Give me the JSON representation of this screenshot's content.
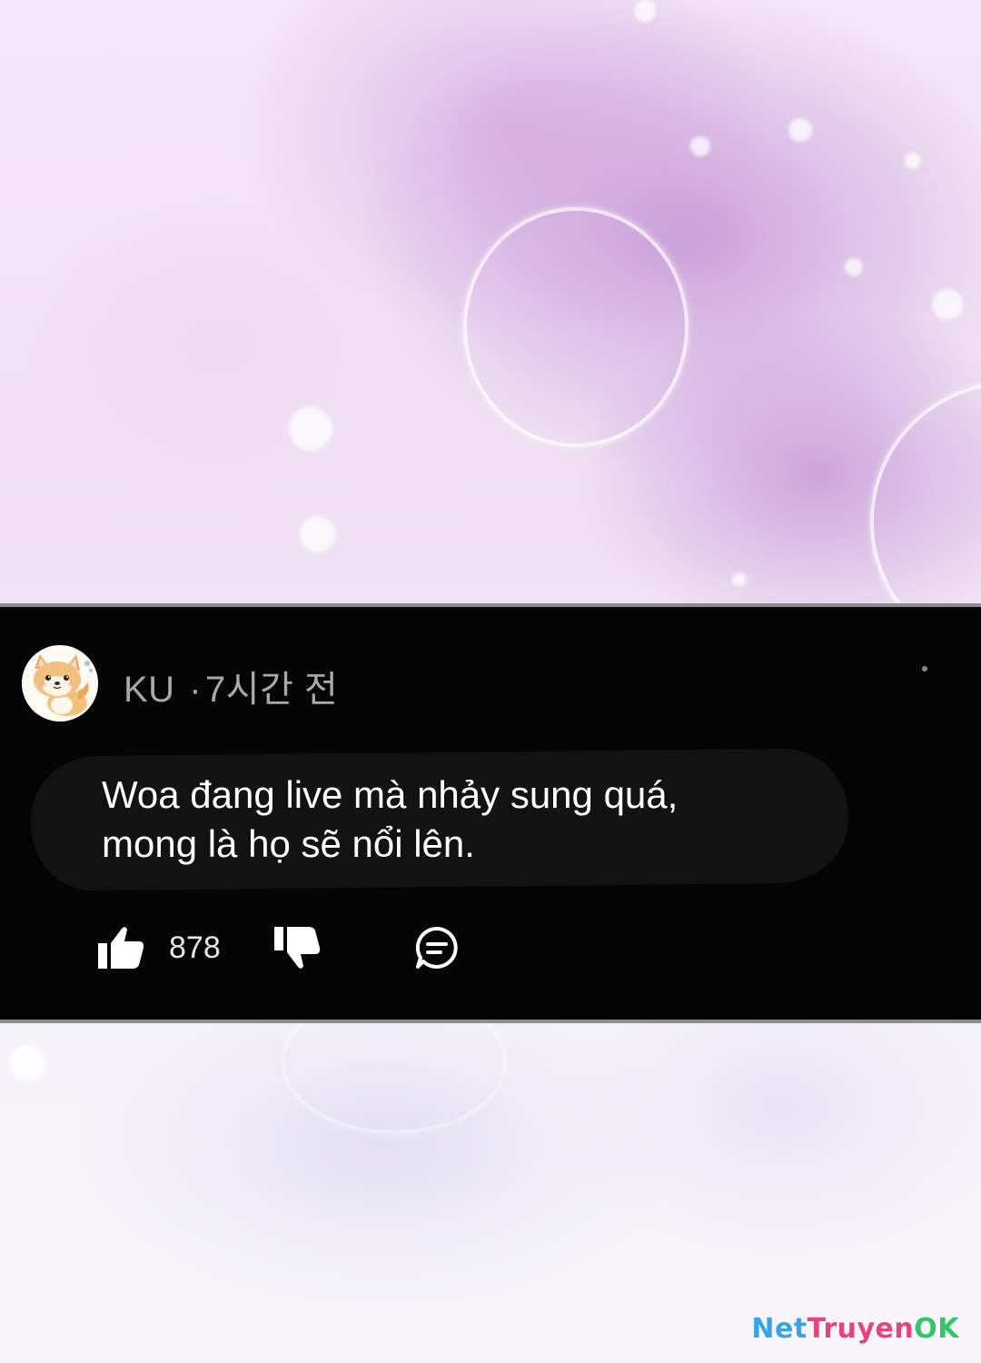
{
  "comment": {
    "author": "KU",
    "separator": "·",
    "time_ago": "7시간 전",
    "text_line_1": "Woa đang live mà nhảy sung quá,",
    "text_line_2": "mong là họ sẽ nổi lên.",
    "like_count": "878",
    "avatar_icon": "shiba-dog-avatar-icon",
    "like_icon": "thumbs-up-icon",
    "dislike_icon": "thumbs-down-icon",
    "reply_icon": "comment-bubble-icon"
  },
  "watermark": {
    "part1": "Net",
    "part2": "Truyen",
    "part3": "OK"
  },
  "colors": {
    "panel_bg": "#050505",
    "panel_border": "#8c8c8c",
    "meta_text": "#a9a9a9",
    "comment_text": "#ffffff",
    "watermark_blue": "#36a5e8",
    "watermark_pink": "#e6447a",
    "watermark_green": "#36c46a"
  }
}
